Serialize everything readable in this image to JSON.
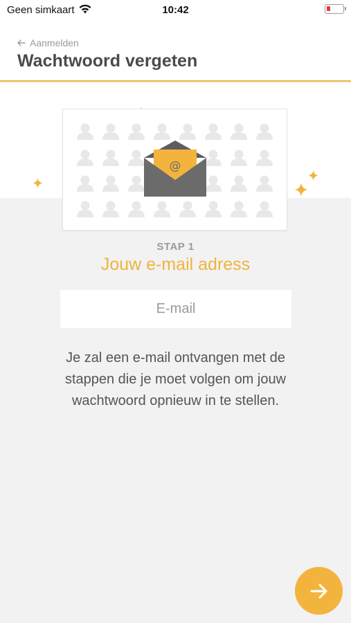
{
  "status_bar": {
    "carrier": "Geen simkaart",
    "time": "10:42",
    "battery_level": 0.1,
    "battery_color": "#e53935"
  },
  "header": {
    "back_label": "Aanmelden",
    "title": "Wachtwoord vergeten",
    "accent_color": "#f0b43c"
  },
  "illustration": {
    "icon": "envelope-at-icon",
    "envelope_color": "#6b6b6b",
    "letter_color": "#f3b43e",
    "letter_symbol": "@",
    "placeholder_figure_color": "#e8e8e8"
  },
  "step": {
    "label": "STAP 1",
    "title": "Jouw e-mail adress"
  },
  "email_input": {
    "value": "",
    "placeholder": "E-mail"
  },
  "info": {
    "text": "Je zal een e-mail ontvangen met de stappen die je moet volgen om jouw wachtwoord opnieuw in te stellen."
  },
  "next_button": {
    "icon": "arrow-right-icon",
    "color": "#f3b43e"
  }
}
